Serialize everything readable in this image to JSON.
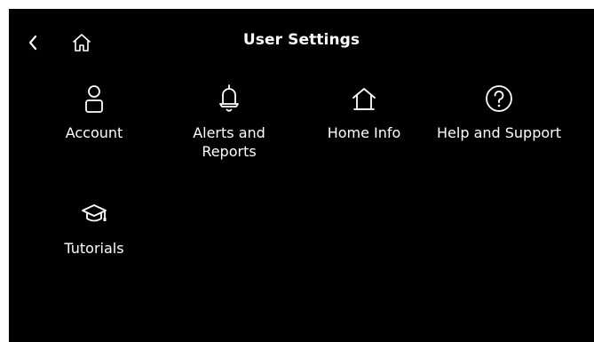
{
  "header": {
    "title": "User Settings",
    "back_icon": "chevron-left-icon",
    "home_icon": "home-icon"
  },
  "tiles": [
    {
      "label": "Account",
      "icon": "user-icon"
    },
    {
      "label": "Alerts and\nReports",
      "icon": "bell-icon"
    },
    {
      "label": "Home Info",
      "icon": "house-icon"
    },
    {
      "label": "Help and Support",
      "icon": "help-icon"
    },
    {
      "label": "Tutorials",
      "icon": "graduation-cap-icon"
    }
  ],
  "colors": {
    "background": "#000000",
    "foreground": "#ffffff"
  }
}
